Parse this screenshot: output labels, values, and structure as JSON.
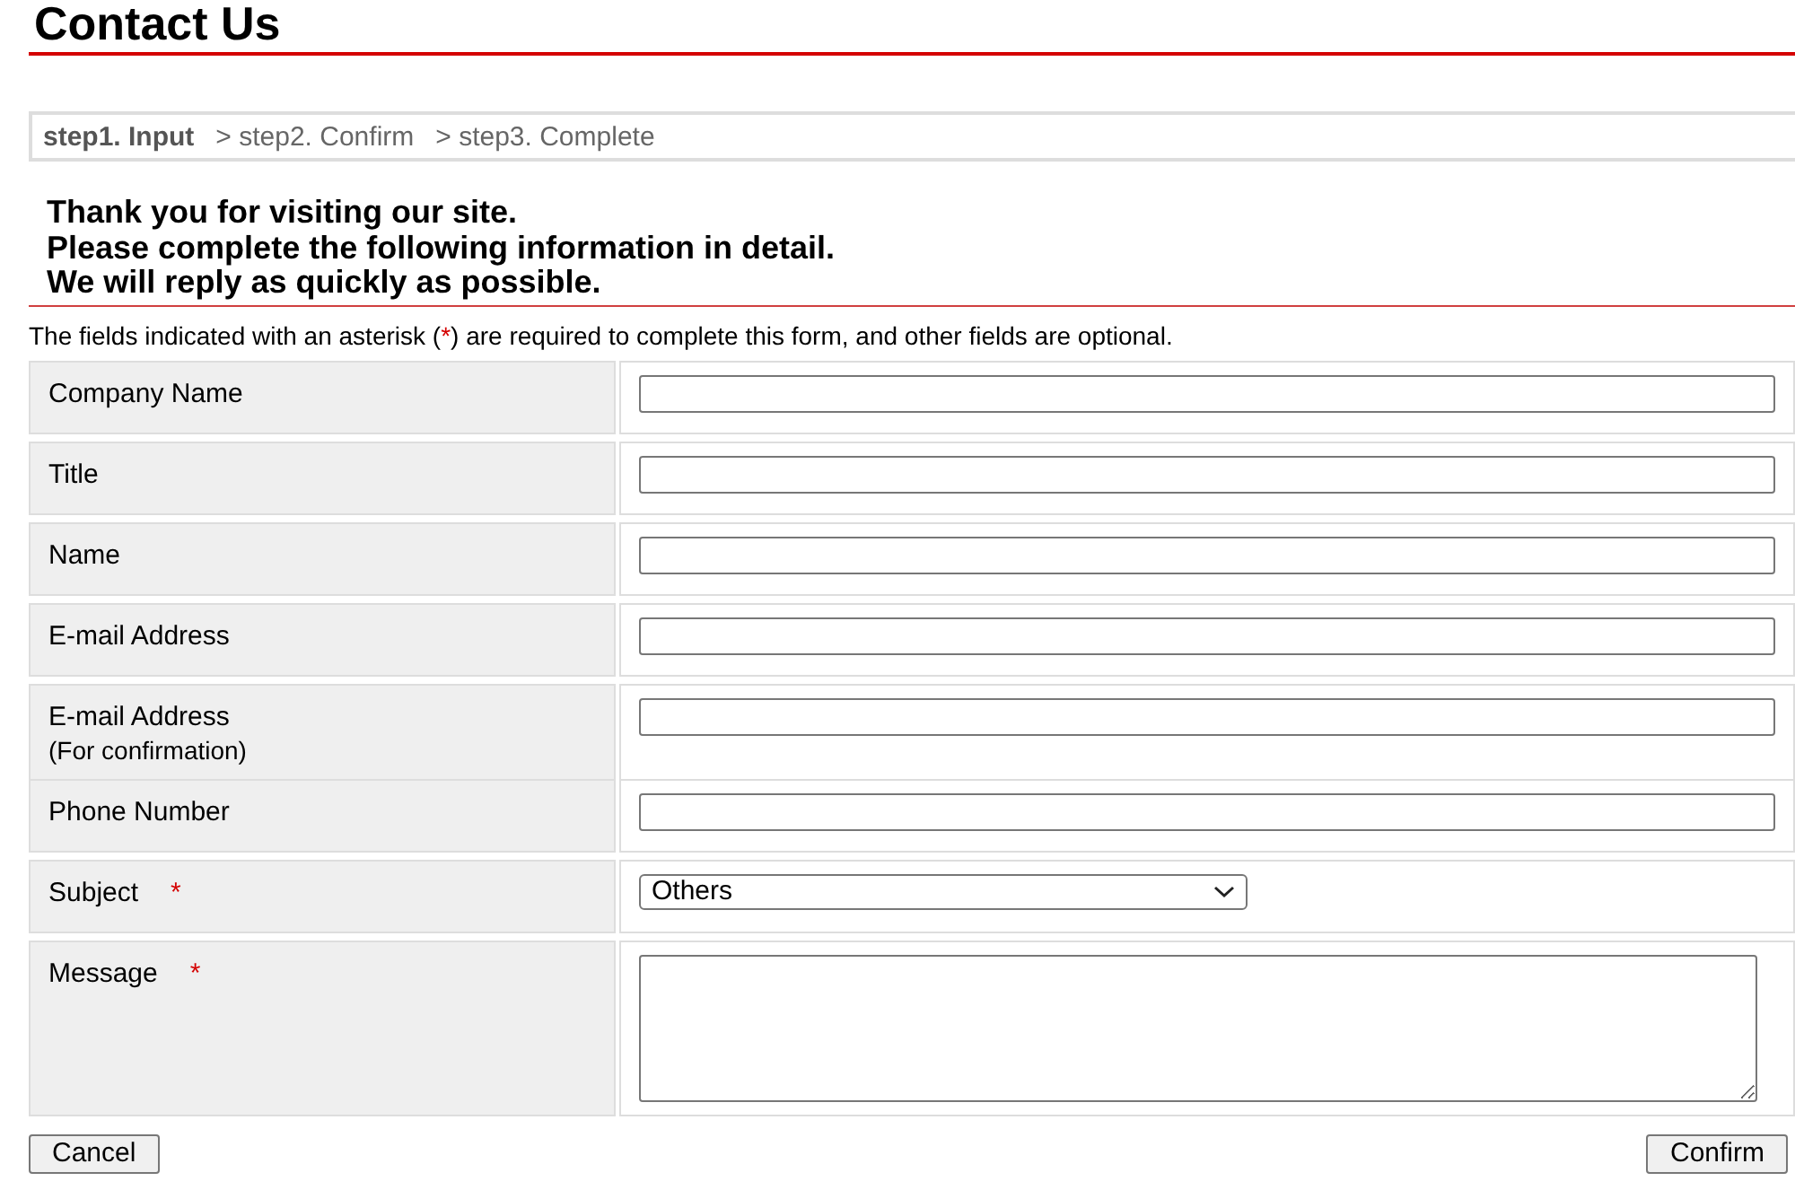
{
  "title": "Contact Us",
  "steps": [
    {
      "label": "step1. Input",
      "selected": true
    },
    {
      "label": "> step2. Confirm",
      "selected": false
    },
    {
      "label": "> step3. Complete",
      "selected": false
    }
  ],
  "intro": [
    "Thank you for visiting our site.",
    "Please complete the following information in detail.",
    "We will reply as quickly as possible."
  ],
  "note": {
    "before": "The fields indicated with an asterisk (",
    "mark": "*",
    "after": ") are required to complete this form, and other fields are optional."
  },
  "fields": [
    {
      "label": "Company Name",
      "kind": "text"
    },
    {
      "label": "Title",
      "kind": "text"
    },
    {
      "label": "Name",
      "kind": "text"
    },
    {
      "label": "E-mail Address",
      "kind": "text"
    },
    {
      "label": "E-mail Address",
      "sublabel": "(For confirmation)",
      "kind": "text"
    },
    {
      "label": "Phone Number",
      "kind": "text"
    },
    {
      "label": "Subject",
      "required_mark": "*",
      "kind": "select",
      "value": "Others"
    },
    {
      "label": "Message",
      "required_mark": "*",
      "kind": "textarea"
    }
  ],
  "buttons": {
    "cancel": "Cancel",
    "confirm": "Confirm"
  }
}
